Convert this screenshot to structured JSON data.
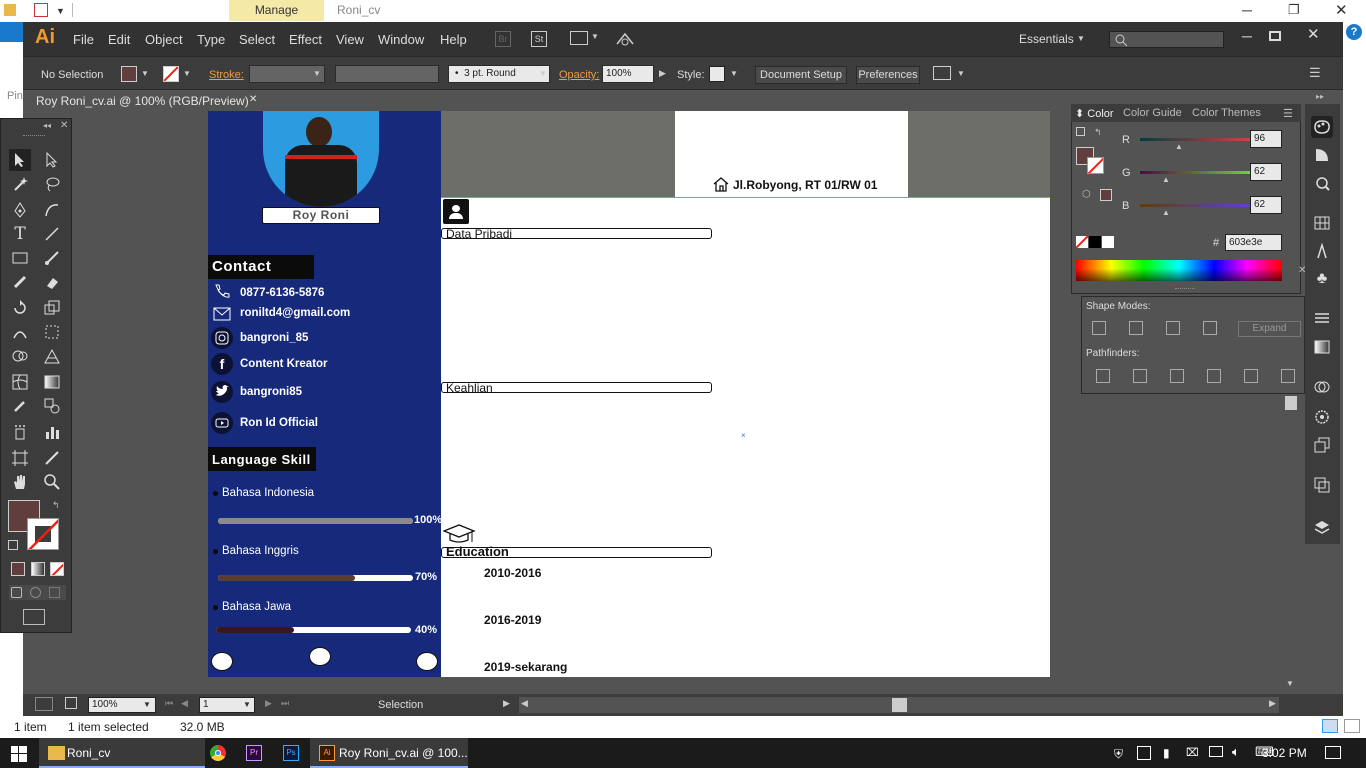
{
  "explorer": {
    "manage_tab": "Manage",
    "window_title": "Roni_cv",
    "pin_label": "Pin"
  },
  "app": {
    "logo": "Ai",
    "workspace": "Essentials",
    "br_label": "Br",
    "st_label": "St"
  },
  "menu": [
    "File",
    "Edit",
    "Object",
    "Type",
    "Select",
    "Effect",
    "View",
    "Window",
    "Help"
  ],
  "control_bar": {
    "selection": "No Selection",
    "stroke_label": "Stroke:",
    "brush": "3 pt. Round",
    "opacity_label": "Opacity:",
    "opacity": "100%",
    "style_label": "Style:",
    "doc_setup": "Document Setup",
    "preferences": "Preferences"
  },
  "document_tab": {
    "title": "Roy Roni_cv.ai @ 100% (RGB/Preview)",
    "close": "✕"
  },
  "cv": {
    "name": "Roy Roni",
    "address": "Jl.Robyong, RT 01/RW 01",
    "contact_heading": "Contact",
    "contacts": [
      {
        "icon": "phone-icon",
        "text": "0877-6136-5876"
      },
      {
        "icon": "mail-icon",
        "text": "roniltd4@gmail.com"
      },
      {
        "icon": "instagram-icon",
        "text": "bangroni_85"
      },
      {
        "icon": "facebook-icon",
        "text": "Content Kreator"
      },
      {
        "icon": "twitter-icon",
        "text": "bangroni85"
      },
      {
        "icon": "youtube-icon",
        "text": "Ron Id Official"
      }
    ],
    "language_heading": "Language Skill",
    "languages": [
      {
        "name": "Bahasa Indonesia",
        "percent_label": "100%",
        "level": 1.0,
        "color": "#8a8a8a"
      },
      {
        "name": "Bahasa Inggris",
        "percent_label": "70%",
        "level": 0.7,
        "color": "#5b3a3a"
      },
      {
        "name": "Bahasa Jawa",
        "percent_label": "40%",
        "level": 0.4,
        "color": "#3a1818"
      }
    ],
    "sections": {
      "data_pribadi": "Data Pribadi",
      "keahlian": "Keahlian",
      "education": "Education"
    },
    "education": [
      "2010-2016",
      "2016-2019",
      "2019-sekarang"
    ]
  },
  "color_panel": {
    "tabs": [
      "Color",
      "Color Guide",
      "Color Themes"
    ],
    "r_label": "R",
    "g_label": "G",
    "b_label": "B",
    "r": "96",
    "g": "62",
    "b": "62",
    "hex_label": "#",
    "hex": "603e3e",
    "fill_color": "#603e3e"
  },
  "pathfinder": {
    "shape_modes": "Shape Modes:",
    "pathfinders": "Pathfinders:",
    "expand": "Expand"
  },
  "status": {
    "zoom": "100%",
    "page": "1",
    "tool": "Selection"
  },
  "explorer_status": {
    "items": "1 item",
    "selected": "1 item selected",
    "size": "32.0 MB"
  },
  "taskbar": {
    "explorer_item": "Roni_cv",
    "ai_item": "Roy Roni_cv.ai @ 100...",
    "time": "3:02 PM",
    "pr_label": "Pr",
    "ps_label": "Ps",
    "ai_label": "Ai"
  }
}
